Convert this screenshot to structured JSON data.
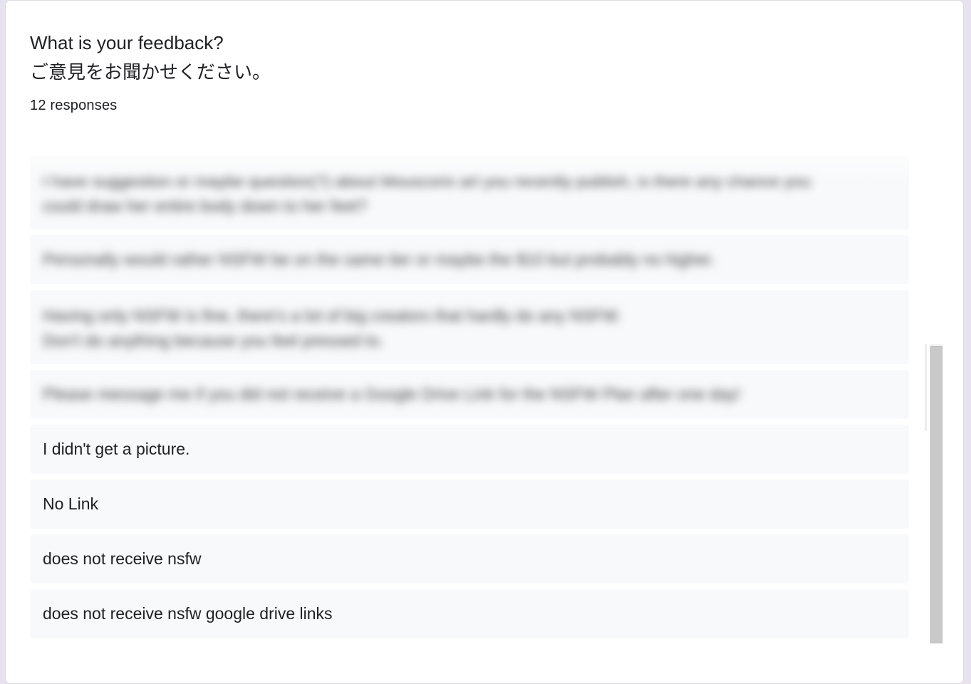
{
  "question": {
    "title": "What is your feedback?\nご意見をお聞かせください。",
    "response_count": "12 responses"
  },
  "responses": [
    {
      "text": "I have suggestion or maybe question(?) about Mouscorix art you recently publish, is there any chance you\ncould draw her entire body down to her feet?",
      "blurred": true
    },
    {
      "text": "Personally would rather NSFW be on the same tier or maybe the $10 but probably no higher.",
      "blurred": true
    },
    {
      "text": "Having only NSFW is fine, there's a lot of big creators that hardly do any NSFW.\nDon't do anything because you feel pressed to.",
      "blurred": true
    },
    {
      "text": "Please message me if you did not receive a Google Drive Link for the NSFW Plan after one day!",
      "blurred": true
    },
    {
      "text": "I didn't get a picture.",
      "blurred": false
    },
    {
      "text": "No Link",
      "blurred": false
    },
    {
      "text": "does not receive nsfw",
      "blurred": false
    },
    {
      "text": "does not receive nsfw google drive links",
      "blurred": false
    }
  ]
}
